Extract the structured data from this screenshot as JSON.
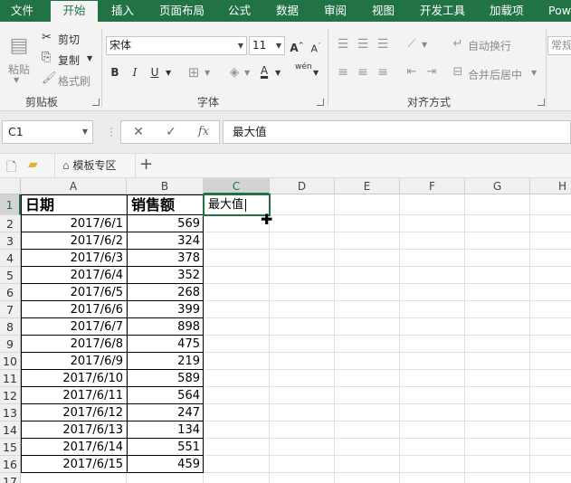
{
  "ribbon_tabs": [
    {
      "label": "文件",
      "active": false
    },
    {
      "label": "开始",
      "active": true
    },
    {
      "label": "插入",
      "active": false
    },
    {
      "label": "页面布局",
      "active": false
    },
    {
      "label": "公式",
      "active": false
    },
    {
      "label": "数据",
      "active": false
    },
    {
      "label": "审阅",
      "active": false
    },
    {
      "label": "视图",
      "active": false
    },
    {
      "label": "开发工具",
      "active": false
    },
    {
      "label": "加载项",
      "active": false
    },
    {
      "label": "Pow",
      "active": false
    }
  ],
  "clipboard": {
    "paste": "粘贴",
    "cut": "剪切",
    "copy": "复制",
    "format_painter": "格式刷",
    "group_label": "剪贴板"
  },
  "font": {
    "name": "宋体",
    "size": "11",
    "bold": "B",
    "italic": "I",
    "underline": "U",
    "wen": "wén",
    "group_label": "字体"
  },
  "alignment": {
    "wrap_text": "自动换行",
    "merge_center": "合并后居中",
    "group_label": "对齐方式"
  },
  "number": {
    "format": "常规"
  },
  "formula_bar": {
    "name_box": "C1",
    "cancel": "✕",
    "enter": "✓",
    "fx": "fx",
    "content": "最大值"
  },
  "doc_tabs": {
    "template_tab": "模板专区",
    "add": "+"
  },
  "grid": {
    "columns": [
      "A",
      "B",
      "C",
      "D",
      "E",
      "F",
      "G",
      "H"
    ],
    "selected_column": "C",
    "rows": [
      "1",
      "2",
      "3",
      "4",
      "5",
      "6",
      "7",
      "8",
      "9",
      "10",
      "11",
      "12",
      "13",
      "14",
      "15",
      "16",
      "17"
    ],
    "selected_row": "1",
    "header_cells": {
      "a": "日期",
      "b": "销售额",
      "c": "最大值"
    },
    "data": [
      {
        "date": "2017/6/1",
        "sales": "569"
      },
      {
        "date": "2017/6/2",
        "sales": "324"
      },
      {
        "date": "2017/6/3",
        "sales": "378"
      },
      {
        "date": "2017/6/4",
        "sales": "352"
      },
      {
        "date": "2017/6/5",
        "sales": "268"
      },
      {
        "date": "2017/6/6",
        "sales": "399"
      },
      {
        "date": "2017/6/7",
        "sales": "898"
      },
      {
        "date": "2017/6/8",
        "sales": "475"
      },
      {
        "date": "2017/6/9",
        "sales": "219"
      },
      {
        "date": "2017/6/10",
        "sales": "589"
      },
      {
        "date": "2017/6/11",
        "sales": "564"
      },
      {
        "date": "2017/6/12",
        "sales": "247"
      },
      {
        "date": "2017/6/13",
        "sales": "134"
      },
      {
        "date": "2017/6/14",
        "sales": "551"
      },
      {
        "date": "2017/6/15",
        "sales": "459"
      }
    ]
  },
  "colors": {
    "accent": "#217346",
    "ribbon_bg": "#f3f3f3"
  }
}
